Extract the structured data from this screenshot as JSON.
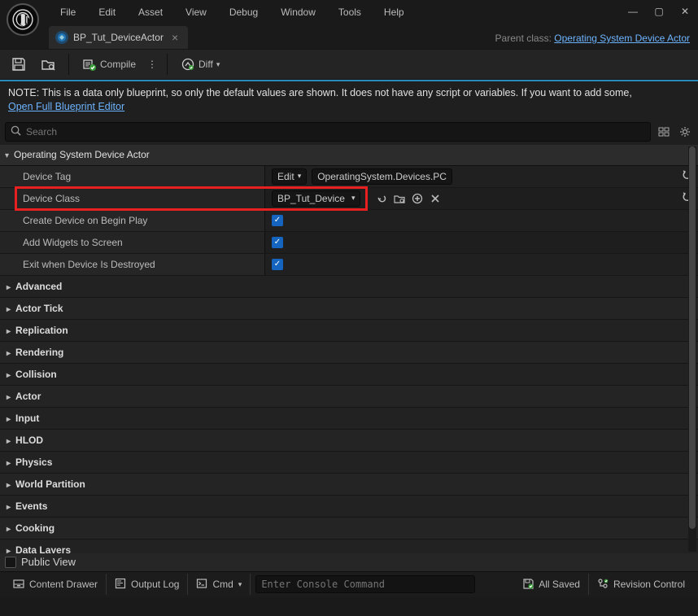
{
  "menu": [
    "File",
    "Edit",
    "Asset",
    "View",
    "Debug",
    "Window",
    "Tools",
    "Help"
  ],
  "tab": {
    "title": "BP_Tut_DeviceActor"
  },
  "parent_class": {
    "label": "Parent class:",
    "link": "Operating System Device Actor"
  },
  "toolbar": {
    "compile": "Compile",
    "diff": "Diff"
  },
  "note": {
    "text": "NOTE: This is a data only blueprint, so only the default values are shown.  It does not have any script or variables.  If you want to add some,",
    "link": "Open Full Blueprint Editor"
  },
  "search": {
    "placeholder": "Search"
  },
  "category": "Operating System Device Actor",
  "props": {
    "device_tag": {
      "label": "Device Tag",
      "edit": "Edit",
      "value": "OperatingSystem.Devices.PC"
    },
    "device_class": {
      "label": "Device Class",
      "value": "BP_Tut_Device"
    },
    "create_begin": {
      "label": "Create Device on Begin Play"
    },
    "add_widgets": {
      "label": "Add Widgets to Screen"
    },
    "exit_destroyed": {
      "label": "Exit when Device Is Destroyed"
    }
  },
  "sections": [
    "Advanced",
    "Actor Tick",
    "Replication",
    "Rendering",
    "Collision",
    "Actor",
    "Input",
    "HLOD",
    "Physics",
    "World Partition",
    "Events",
    "Cooking",
    "Data Layers"
  ],
  "public_view": "Public View",
  "bottom": {
    "content_drawer": "Content Drawer",
    "output_log": "Output Log",
    "cmd": "Cmd",
    "console_placeholder": "Enter Console Command",
    "all_saved": "All Saved",
    "revision": "Revision Control"
  }
}
